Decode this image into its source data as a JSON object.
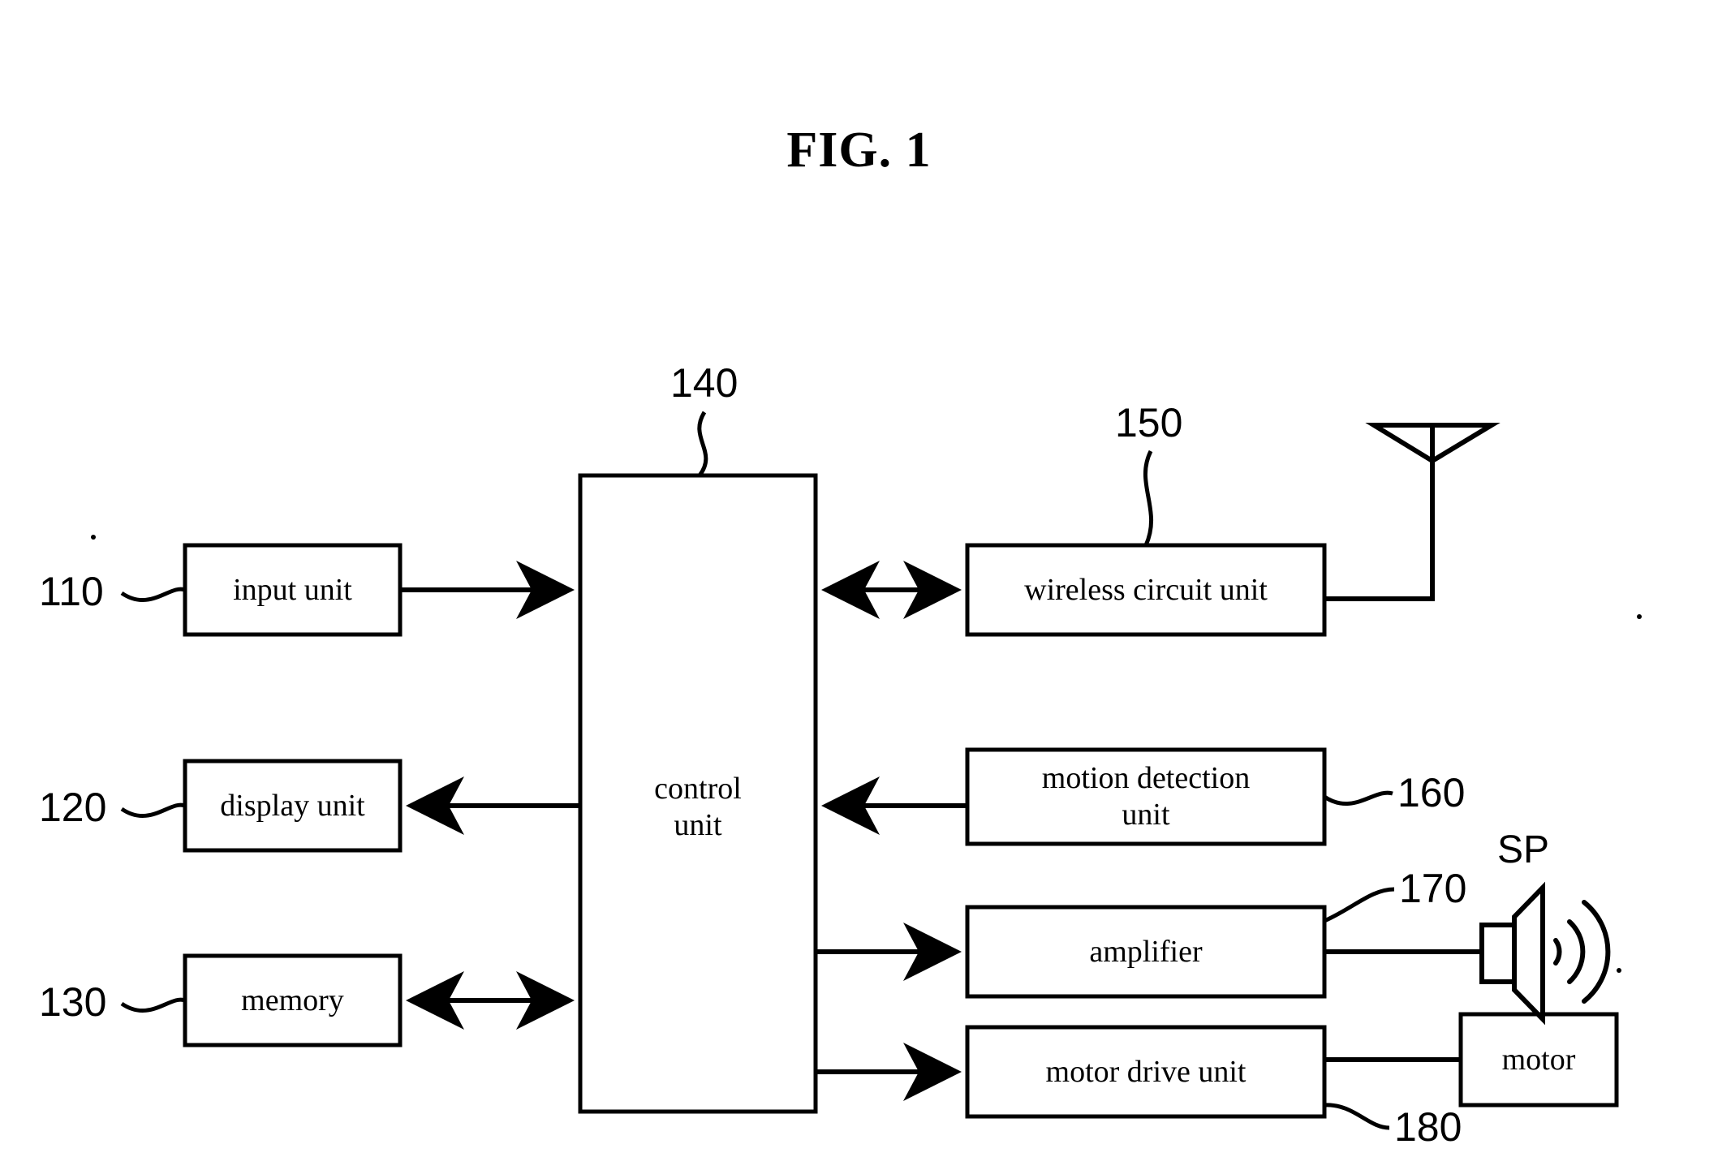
{
  "figure": {
    "title": "FIG. 1",
    "stroke_color": "#000000",
    "background_color": "#ffffff"
  },
  "blocks": [
    {
      "id": "input_unit",
      "label": "input unit",
      "ref": "110"
    },
    {
      "id": "display_unit",
      "label": "display unit",
      "ref": "120"
    },
    {
      "id": "memory",
      "label": "memory",
      "ref": "130"
    },
    {
      "id": "control_unit",
      "label": "control\nunit",
      "ref": "140"
    },
    {
      "id": "wireless_circuit",
      "label": "wireless circuit unit",
      "ref": "150"
    },
    {
      "id": "motion_detection",
      "label": "motion detection\nunit",
      "ref": "160"
    },
    {
      "id": "amplifier",
      "label": "amplifier",
      "ref": "170"
    },
    {
      "id": "motor_drive_unit",
      "label": "motor drive unit",
      "ref": "180"
    },
    {
      "id": "motor",
      "label": "motor",
      "ref": ""
    }
  ],
  "ref_numbers": {
    "input_unit": "110",
    "display_unit": "120",
    "memory": "130",
    "control_unit": "140",
    "wireless_circuit": "150",
    "motion_detection": "160",
    "amplifier": "170",
    "motor_drive_unit": "180"
  },
  "component_labels": {
    "speaker": "SP"
  },
  "icons": {
    "antenna": "antenna-icon",
    "speaker": "speaker-icon",
    "sound_waves": "sound-waves-icon"
  },
  "connections": [
    {
      "from": "input_unit",
      "to": "control_unit",
      "direction": "one-way"
    },
    {
      "from": "control_unit",
      "to": "display_unit",
      "direction": "one-way"
    },
    {
      "from": "memory",
      "to": "control_unit",
      "direction": "two-way"
    },
    {
      "from": "control_unit",
      "to": "wireless_circuit",
      "direction": "two-way"
    },
    {
      "from": "motion_detection",
      "to": "control_unit",
      "direction": "one-way"
    },
    {
      "from": "control_unit",
      "to": "amplifier",
      "direction": "one-way"
    },
    {
      "from": "control_unit",
      "to": "motor_drive_unit",
      "direction": "one-way"
    },
    {
      "from": "wireless_circuit",
      "to": "antenna",
      "direction": "plain"
    },
    {
      "from": "amplifier",
      "to": "speaker",
      "direction": "plain"
    },
    {
      "from": "motor_drive_unit",
      "to": "motor",
      "direction": "plain"
    }
  ]
}
